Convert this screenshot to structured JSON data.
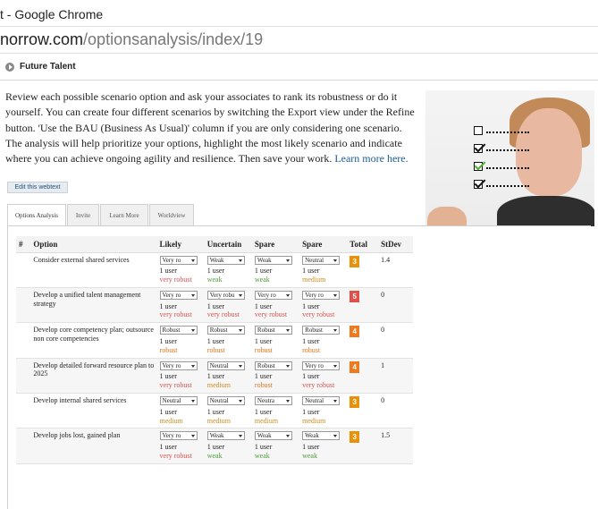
{
  "window": {
    "title": "t - Google Chrome"
  },
  "address": {
    "host": "norrow.com",
    "path": "/optionsanalysis/index/19"
  },
  "section": {
    "title": "Future Talent"
  },
  "intro": {
    "text": "Review each possible scenario option and ask your associates to rank its robustness or do it yourself. You can create four different scenarios by switching the Export view under the Refine button. 'Use the BAU (Business As Usual)' column if you are only considering one scenario. The analysis will help prioritize your options, highlight the most likely scenario and indicate where you can achieve ongoing agility and resilience. Then save your work.",
    "link": "Learn more here."
  },
  "edit_button": "Edit this webtext",
  "tabs": [
    "Options Analysis",
    "Invite",
    "Learn More",
    "Worldview"
  ],
  "table": {
    "headers": [
      "#",
      "Option",
      "Likely",
      "Uncertain",
      "Spare",
      "Spare",
      "Total",
      "StDev"
    ],
    "rows": [
      {
        "option": "Consider external shared services",
        "cells": [
          {
            "select": "Very ro",
            "users": "1 user",
            "level": "very robust",
            "cls": "very-robust"
          },
          {
            "select": "Weak",
            "users": "1 user",
            "level": "weak",
            "cls": "weak"
          },
          {
            "select": "Weak",
            "users": "1 user",
            "level": "weak",
            "cls": "weak"
          },
          {
            "select": "Neutral",
            "users": "1 user",
            "level": "medium",
            "cls": "medium"
          }
        ],
        "total": "3",
        "total_color": "#e8920c",
        "stdev": "1.4"
      },
      {
        "option": "Develop a unified talent management strategy",
        "cells": [
          {
            "select": "Very ro",
            "users": "1 user",
            "level": "very robust",
            "cls": "very-robust"
          },
          {
            "select": "Very robu",
            "users": "1 user",
            "level": "very robust",
            "cls": "very-robust"
          },
          {
            "select": "Very ro",
            "users": "1 user",
            "level": "very robust",
            "cls": "very-robust"
          },
          {
            "select": "Very ro",
            "users": "1 user",
            "level": "very robust",
            "cls": "very-robust"
          }
        ],
        "total": "5",
        "total_color": "#e2504a",
        "stdev": "0"
      },
      {
        "option": "Develop core competency plan; outsource non core competencies",
        "cells": [
          {
            "select": "Robust",
            "users": "1 user",
            "level": "robust",
            "cls": "robust"
          },
          {
            "select": "Robust",
            "users": "1 user",
            "level": "robust",
            "cls": "robust"
          },
          {
            "select": "Robust",
            "users": "1 user",
            "level": "robust",
            "cls": "robust"
          },
          {
            "select": "Robust",
            "users": "1 user",
            "level": "robust",
            "cls": "robust"
          }
        ],
        "total": "4",
        "total_color": "#ee7a1d",
        "stdev": "0"
      },
      {
        "option": "Develop detailed forward resource plan to 2025",
        "cells": [
          {
            "select": "Very ro",
            "users": "1 user",
            "level": "very robust",
            "cls": "very-robust"
          },
          {
            "select": "Neutral",
            "users": "1 user",
            "level": "medium",
            "cls": "medium"
          },
          {
            "select": "Robust",
            "users": "1 user",
            "level": "robust",
            "cls": "robust"
          },
          {
            "select": "Very ro",
            "users": "1 user",
            "level": "very robust",
            "cls": "very-robust"
          }
        ],
        "total": "4",
        "total_color": "#ee7a1d",
        "stdev": "1"
      },
      {
        "option": "Develop internal shared services",
        "cells": [
          {
            "select": "Neutral",
            "users": "1 user",
            "level": "medium",
            "cls": "medium"
          },
          {
            "select": "Neutral",
            "users": "1 user",
            "level": "medium",
            "cls": "medium"
          },
          {
            "select": "Neutra",
            "users": "1 user",
            "level": "medium",
            "cls": "medium"
          },
          {
            "select": "Neutral",
            "users": "1 user",
            "level": "medium",
            "cls": "medium"
          }
        ],
        "total": "3",
        "total_color": "#e8920c",
        "stdev": "0"
      },
      {
        "option": "Develop jobs lost, gained plan",
        "cells": [
          {
            "select": "Very ro",
            "users": "1 user",
            "level": "very robust",
            "cls": "very-robust"
          },
          {
            "select": "Weak",
            "users": "1 user",
            "level": "weak",
            "cls": "weak"
          },
          {
            "select": "Weak",
            "users": "1 user",
            "level": "weak",
            "cls": "weak"
          },
          {
            "select": "Weak",
            "users": "1 user",
            "level": "weak",
            "cls": "weak"
          }
        ],
        "total": "3",
        "total_color": "#e8920c",
        "stdev": "1.5"
      }
    ]
  }
}
